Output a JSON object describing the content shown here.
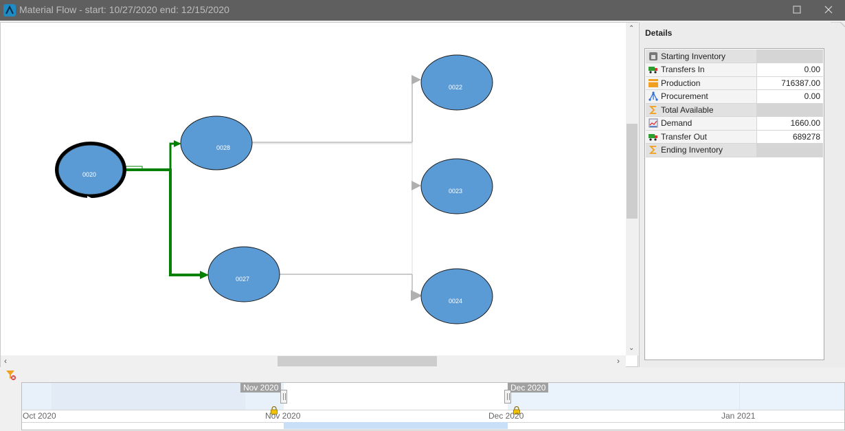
{
  "window": {
    "title": "Material Flow - start: 10/27/2020 end: 12/15/2020",
    "maximize_icon": "maximize-icon",
    "close_icon": "close-icon"
  },
  "graph": {
    "nodes": [
      {
        "id": "0020",
        "label": "0020",
        "selected": true
      },
      {
        "id": "0028",
        "label": "0028"
      },
      {
        "id": "0027",
        "label": "0027"
      },
      {
        "id": "0022",
        "label": "0022"
      },
      {
        "id": "0023",
        "label": "0023"
      },
      {
        "id": "0024",
        "label": "0024"
      }
    ],
    "colors": {
      "node_fill": "#5b9bd5",
      "active_flow": "#008000",
      "inactive_flow": "#b0b0b0"
    }
  },
  "details": {
    "title": "Details",
    "rows": [
      {
        "label": "Starting Inventory",
        "value": "",
        "icon": "warehouse-icon",
        "group": true
      },
      {
        "label": "Transfers In",
        "value": "0.00",
        "icon": "truck-icon"
      },
      {
        "label": "Production",
        "value": "716387.00",
        "icon": "box-icon"
      },
      {
        "label": "Procurement",
        "value": "0.00",
        "icon": "network-icon"
      },
      {
        "label": "Total Available",
        "value": "",
        "icon": "sigma-icon",
        "group": true
      },
      {
        "label": "Demand",
        "value": "1660.00",
        "icon": "chart-icon"
      },
      {
        "label": "Transfer Out",
        "value": "689278",
        "icon": "truck-icon"
      },
      {
        "label": "Ending Inventory",
        "value": "",
        "icon": "sigma-icon",
        "group": true
      }
    ]
  },
  "timeline": {
    "filter_icon": "filter-clear-icon",
    "start_tag": "Nov 2020",
    "end_tag": "Dec 2020",
    "months": [
      "Oct 2020",
      "Nov 2020",
      "Dec 2020",
      "Jan 2021"
    ]
  }
}
